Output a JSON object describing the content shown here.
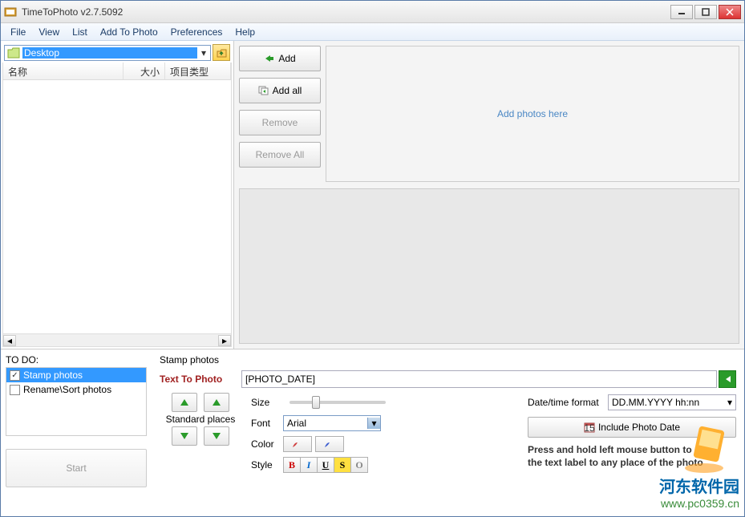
{
  "window": {
    "title": "TimeToPhoto v2.7.5092"
  },
  "menu": {
    "file": "File",
    "view": "View",
    "list": "List",
    "add_to_photo": "Add To Photo",
    "preferences": "Preferences",
    "help": "Help"
  },
  "path": {
    "selected": "Desktop"
  },
  "columns": {
    "name": "名称",
    "size": "大小",
    "type": "项目类型"
  },
  "actions": {
    "add": "Add",
    "add_all": "Add all",
    "remove": "Remove",
    "remove_all": "Remove All"
  },
  "drop_hint": "Add photos here",
  "todo": {
    "label": "TO DO:",
    "items": [
      {
        "label": "Stamp photos",
        "checked": true,
        "selected": true
      },
      {
        "label": "Rename\\Sort photos",
        "checked": false,
        "selected": false
      }
    ],
    "start": "Start"
  },
  "stamp": {
    "group_title": "Stamp photos",
    "text_to_photo_label": "Text To Photo",
    "text_value": "[PHOTO_DATE]",
    "standard_places": "Standard places",
    "size_label": "Size",
    "font_label": "Font",
    "font_value": "Arial",
    "color_label": "Color",
    "style_label": "Style",
    "date_format_label": "Date/time format",
    "date_format_value": "DD.MM.YYYY hh:nn",
    "include_photo_date": "Include Photo Date",
    "hint": "Press and hold left mouse button to move the text label to any place of the photo"
  },
  "style_buttons": {
    "bold": "B",
    "italic": "I",
    "underline": "U",
    "strike": "S",
    "outline": "O"
  },
  "watermark": {
    "line1": "河东软件园",
    "line2": "www.pc0359.cn"
  }
}
